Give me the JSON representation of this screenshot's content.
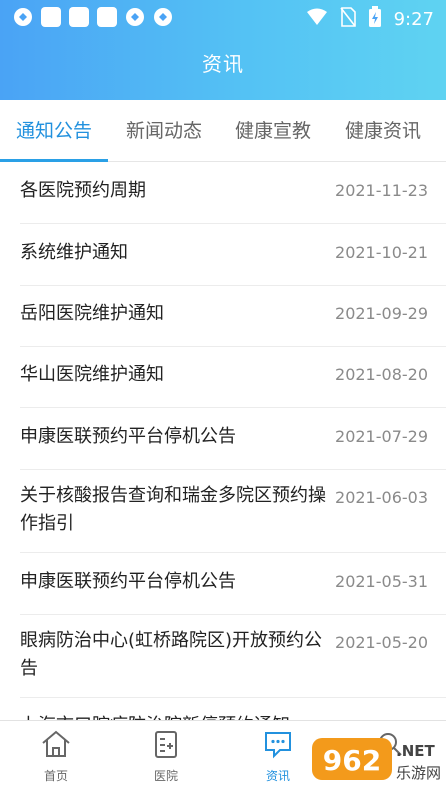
{
  "status_bar": {
    "time": "9:27"
  },
  "header": {
    "title": "资讯"
  },
  "tabs": [
    {
      "label": "通知公告",
      "active": true
    },
    {
      "label": "新闻动态",
      "active": false
    },
    {
      "label": "健康宣教",
      "active": false
    },
    {
      "label": "健康资讯",
      "active": false
    }
  ],
  "notices": [
    {
      "title": "各医院预约周期",
      "date": "2021-11-23"
    },
    {
      "title": "系统维护通知",
      "date": "2021-10-21"
    },
    {
      "title": "岳阳医院维护通知",
      "date": "2021-09-29"
    },
    {
      "title": "华山医院维护通知",
      "date": "2021-08-20"
    },
    {
      "title": "申康医联预约平台停机公告",
      "date": "2021-07-29"
    },
    {
      "title": "关于核酸报告查询和瑞金多院区预约操作指引",
      "date": "2021-06-03"
    },
    {
      "title": "申康医联预约平台停机公告",
      "date": "2021-05-31"
    },
    {
      "title": "眼病防治中心(虹桥路院区)开放预约公告",
      "date": "2021-05-20"
    },
    {
      "title": "上海市口腔病防治院新停预约通知",
      "date": ""
    }
  ],
  "bottom_nav": [
    {
      "label": "首页",
      "icon": "home-icon"
    },
    {
      "label": "医院",
      "icon": "hospital-icon"
    },
    {
      "label": "资讯",
      "icon": "news-icon",
      "active": true
    },
    {
      "label": "",
      "icon": "search-icon"
    }
  ],
  "watermark": {
    "text": "962",
    "suffix": ".NET",
    "sub": "乐游网"
  },
  "colors": {
    "accent": "#2291de",
    "header_start": "#4aa3f5",
    "header_end": "#5fd3f2"
  }
}
